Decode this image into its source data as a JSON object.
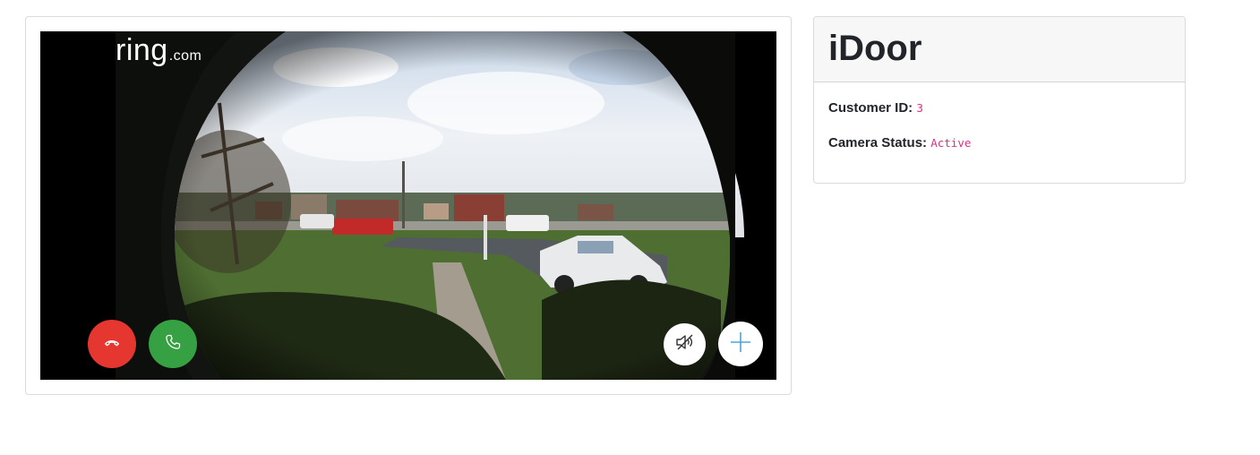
{
  "video": {
    "logo_brand": "ring",
    "logo_tld": ".com",
    "controls": {
      "hangup_icon": "phone-hangup-icon",
      "answer_icon": "phone-icon",
      "mute_icon": "speaker-mute-icon",
      "add_icon": "plus-icon"
    }
  },
  "info": {
    "title": "iDoor",
    "customer_id_label": "Customer ID:",
    "customer_id_value": "3",
    "camera_status_label": "Camera Status:",
    "camera_status_value": "Active"
  },
  "colors": {
    "hangup": "#e53630",
    "answer": "#36a142",
    "code_text": "#d63384",
    "add_icon": "#4aa6d8"
  }
}
